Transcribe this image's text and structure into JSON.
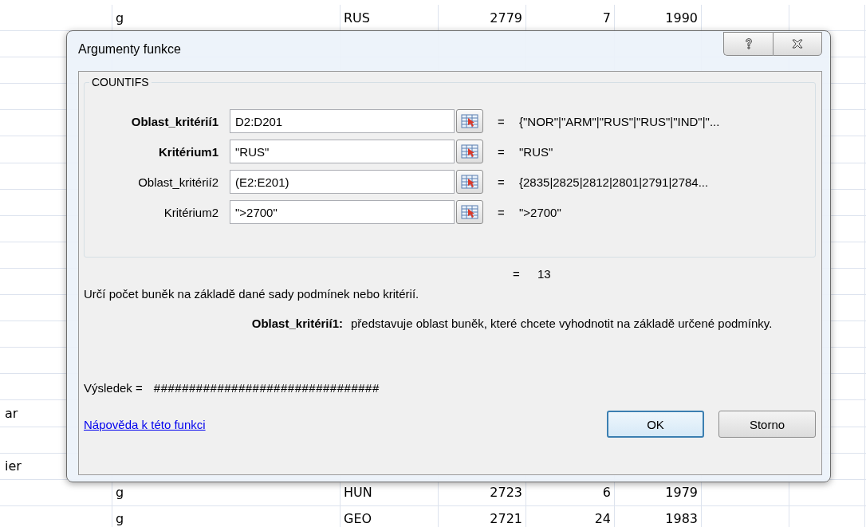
{
  "sheet": {
    "rows": [
      {
        "cells": [
          "g",
          "RUS",
          "2779",
          "7",
          "1990"
        ]
      },
      {},
      {},
      {},
      {},
      {},
      {},
      {},
      {},
      {},
      {},
      {},
      {},
      {},
      {},
      {
        "col_a": "ar"
      },
      {},
      {
        "col_a": "ier"
      },
      {
        "cells": [
          "g",
          "HUN",
          "2723",
          "6",
          "1979"
        ]
      },
      {
        "cells": [
          "g",
          "GEO",
          "2721",
          "24",
          "1983"
        ]
      }
    ]
  },
  "window": {
    "title": "Argumenty funkce"
  },
  "function": {
    "name": "COUNTIFS",
    "arguments": [
      {
        "label": "Oblast_kritérií1",
        "required": true,
        "value": "D2:D201",
        "result": "{\"NOR\"|\"ARM\"|\"RUS\"|\"RUS\"|\"IND\"|\"..."
      },
      {
        "label": "Kritérium1",
        "required": true,
        "value": "\"RUS\"",
        "result": "\"RUS\""
      },
      {
        "label": "Oblast_kritérií2",
        "required": false,
        "value": "(E2:E201)",
        "result": "{2835|2825|2812|2801|2791|2784..."
      },
      {
        "label": "Kritérium2",
        "required": false,
        "value": "\">2700\"",
        "result": "\">2700\""
      }
    ],
    "equals": "=",
    "result": "13",
    "description": "Určí počet buněk na základě dané sady podmínek nebo kritérií.",
    "argument_help": {
      "label": "Oblast_kritérií1:",
      "text": "představuje oblast buněk, které chcete vyhodnotit na základě určené podmínky."
    },
    "formula_result": {
      "label": "Výsledek =",
      "value": "################################"
    }
  },
  "help_link": "Nápověda k této funkci",
  "buttons": [
    {
      "label": "OK",
      "default": true
    },
    {
      "label": "Storno",
      "default": false
    }
  ]
}
